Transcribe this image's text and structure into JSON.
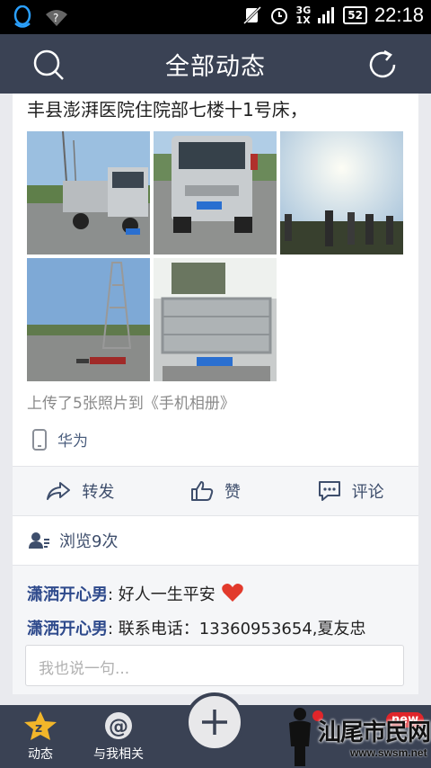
{
  "status_bar": {
    "signal": "3G\n1X",
    "battery": "52",
    "time": "22:18"
  },
  "header": {
    "title": "全部动态"
  },
  "post": {
    "text": "丰县澎湃医院住院部七楼十1号床，",
    "upload_info": "上传了5张照片到《手机相册》",
    "device": "华为",
    "actions": {
      "share": "转发",
      "like": "赞",
      "comment": "评论"
    },
    "views": "浏览9次",
    "comments": [
      {
        "user": "潇洒开心男",
        "sep": ": ",
        "text": "好人一生平安"
      },
      {
        "user": "潇洒开心男",
        "sep": ": ",
        "text": "联系电话：13360953654,夏友忠"
      }
    ],
    "reply_placeholder": "我也说一句..."
  },
  "bottom_nav": {
    "feed": "动态",
    "related": "与我相关",
    "badge_new": "new"
  },
  "watermark": {
    "text": "汕尾市民网",
    "url": "www.swsm.net"
  },
  "colors": {
    "nav_bg": "#3a4254",
    "link": "#2e4a8c",
    "accent_red": "#e0252a"
  }
}
